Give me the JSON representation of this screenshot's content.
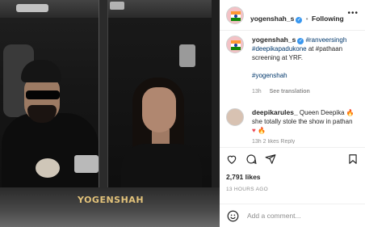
{
  "photo": {
    "watermark": "YOGENSHAH"
  },
  "header": {
    "username": "yogenshah_s",
    "dot": "•",
    "follow_label": "Following",
    "more_icon": "more-horizontal-icon"
  },
  "post": {
    "author": "yogenshah_s",
    "caption_tags": "#ranveersingh #deepikapadukone",
    "caption_text": " at #pathaan screening at YRF.",
    "hashtag": "#yogenshah",
    "time": "13h",
    "see_translation": "See translation"
  },
  "comment": {
    "username": "deepikarules_",
    "text": " Queen Deepika 🔥 she totally stole the show in pathan",
    "hearts": "♥ 🔥",
    "partial_meta": "13h  2 likes  Reply"
  },
  "actions": {
    "like_icon": "heart-icon",
    "comment_icon": "comment-icon",
    "share_icon": "send-icon",
    "save_icon": "bookmark-icon"
  },
  "likes": "2,791 likes",
  "time_ago": "13 HOURS AGO",
  "add_comment": {
    "emoji_icon": "smiley-icon",
    "placeholder": "Add a comment..."
  },
  "colors": {
    "link": "#00376b",
    "verified": "#3897f0",
    "muted": "#8e8e8e",
    "watermark": "#e2c27a"
  }
}
